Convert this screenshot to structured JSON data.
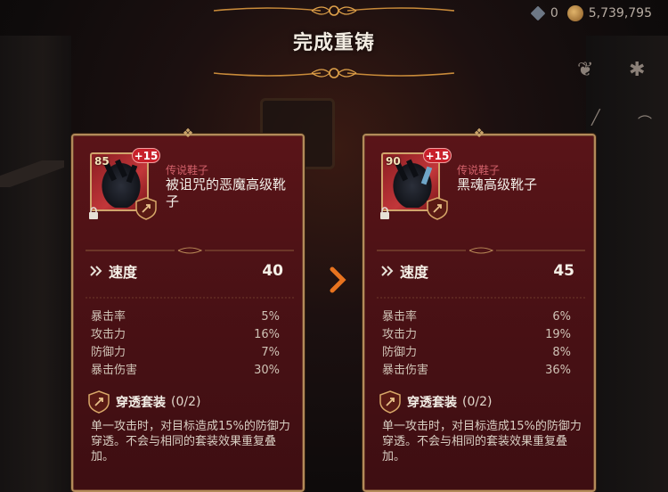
{
  "topbar": {
    "gems": "0",
    "gold": "5,739,795"
  },
  "title": "完成重铸",
  "cards": [
    {
      "level": "85",
      "enhance": "+15",
      "rarity": "传说鞋子",
      "name": "被诅咒的恶魔高级靴子",
      "main_stat": {
        "label": "速度",
        "value": "40"
      },
      "sub_stats": [
        {
          "label": "暴击率",
          "value": "5%"
        },
        {
          "label": "攻击力",
          "value": "16%"
        },
        {
          "label": "防御力",
          "value": "7%"
        },
        {
          "label": "暴击伤害",
          "value": "30%"
        }
      ],
      "set": {
        "name": "穿透套装",
        "count": "(0/2)",
        "desc": "单一攻击时，对目标造成15%的防御力穿透。不会与相同的套装效果重复叠加。"
      }
    },
    {
      "level": "90",
      "enhance": "+15",
      "rarity": "传说鞋子",
      "name": "黑魂高级靴子",
      "main_stat": {
        "label": "速度",
        "value": "45"
      },
      "sub_stats": [
        {
          "label": "暴击率",
          "value": "6%"
        },
        {
          "label": "攻击力",
          "value": "19%"
        },
        {
          "label": "防御力",
          "value": "8%"
        },
        {
          "label": "暴击伤害",
          "value": "36%"
        }
      ],
      "set": {
        "name": "穿透套装",
        "count": "(0/2)",
        "desc": "单一攻击时，对目标造成15%的防御力穿透。不会与相同的套装效果重复叠加。"
      }
    }
  ],
  "colors": {
    "accent_orange": "#e8731f",
    "rarity_red": "#d1616a",
    "card_bg": "#4a1115",
    "frame_gold": "#b38b5a"
  }
}
